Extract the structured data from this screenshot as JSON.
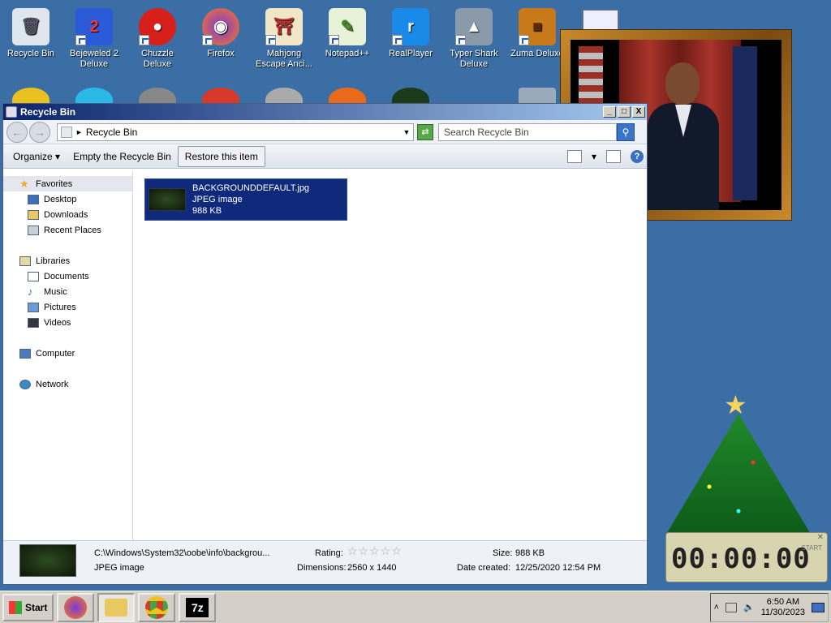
{
  "desktop": {
    "icons": [
      {
        "label": "Recycle Bin",
        "glyph": "🗑"
      },
      {
        "label": "Bejeweled 2 Deluxe",
        "glyph": "2"
      },
      {
        "label": "Chuzzle Deluxe",
        "glyph": "●"
      },
      {
        "label": "Firefox",
        "glyph": "◉"
      },
      {
        "label": "Mahjong Escape Anci...",
        "glyph": "⛩"
      },
      {
        "label": "Notepad++",
        "glyph": "✎"
      },
      {
        "label": "RealPlayer",
        "glyph": "r"
      },
      {
        "label": "Typer Shark Deluxe",
        "glyph": "▲"
      },
      {
        "label": "Zuma Deluxe",
        "glyph": "■"
      }
    ],
    "clock": "00:00:00",
    "clock_btn": "START"
  },
  "window": {
    "title": "Recycle Bin",
    "controls": {
      "minimize": "_",
      "maximize": "□",
      "close": "X"
    },
    "address": "Recycle Bin",
    "search_placeholder": "Search Recycle Bin",
    "toolbar": {
      "organize": "Organize",
      "empty": "Empty the Recycle Bin",
      "restore": "Restore this item"
    },
    "nav": {
      "favorites": "Favorites",
      "desktop": "Desktop",
      "downloads": "Downloads",
      "recent": "Recent Places",
      "libraries": "Libraries",
      "documents": "Documents",
      "music": "Music",
      "pictures": "Pictures",
      "videos": "Videos",
      "computer": "Computer",
      "network": "Network"
    },
    "file": {
      "name": "BACKGROUNDDEFAULT.jpg",
      "type": "JPEG image",
      "size": "988 KB"
    },
    "details": {
      "path": "C:\\Windows\\System32\\oobe\\info\\backgrou...",
      "type": "JPEG image",
      "rating_label": "Rating:",
      "rating_stars": "☆☆☆☆☆",
      "dimensions_label": "Dimensions:",
      "dimensions": "2560 x 1440",
      "size_label": "Size:",
      "size": "988 KB",
      "created_label": "Date created:",
      "created": "12/25/2020 12:54 PM"
    }
  },
  "taskbar": {
    "start": "Start",
    "time": "6:50 AM",
    "date": "11/30/2023",
    "tray_arrow": "˄",
    "seven_zip": "7z"
  },
  "colors": {
    "desktop": "#3a6ea5",
    "selection": "#0f2a7a",
    "titlebar": "#0a246a"
  }
}
